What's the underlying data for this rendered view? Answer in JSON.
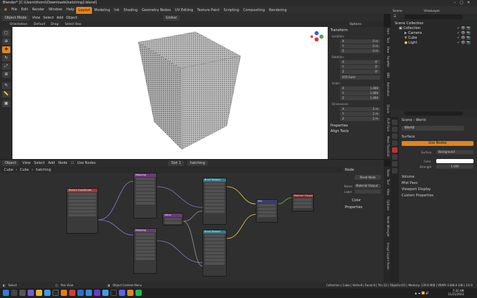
{
  "window_title": "Blender* [C:\\Users\\thomi\\Downloads\\hatching2.blend]",
  "menu": [
    "File",
    "Edit",
    "Render",
    "Window",
    "Help"
  ],
  "workspaces": [
    "Layout",
    "Modeling",
    "Ink",
    "Shading",
    "Geometry Nodes",
    "UV Editing",
    "Texture Paint",
    "Scripting",
    "Compositing",
    "Rendering"
  ],
  "active_workspace": "Layout",
  "scene_label": "Scene",
  "viewlayer_label": "ViewLayer",
  "viewport_header": {
    "mode": "Object Mode",
    "items": [
      "View",
      "Select",
      "Add",
      "Object"
    ],
    "orientation": "Global",
    "options": "Options"
  },
  "viewport_toolhdr": {
    "orientation_label": "Orientation:",
    "orientation_value": "Default",
    "drag_label": "Drag:",
    "drag_value": "Select Box"
  },
  "npanel": {
    "transform_title": "Transform",
    "location_label": "Location:",
    "location": [
      {
        "axis": "X",
        "value": "0 m"
      },
      {
        "axis": "Y",
        "value": "0 m"
      },
      {
        "axis": "Z",
        "value": "0 m"
      }
    ],
    "rotation_label": "Rotation:",
    "rotation": [
      {
        "axis": "X",
        "value": "0°"
      },
      {
        "axis": "Y",
        "value": "0°"
      },
      {
        "axis": "Z",
        "value": "0°"
      }
    ],
    "rotation_mode": "XYZ Euler",
    "scale_label": "Scale:",
    "scale": [
      {
        "axis": "X",
        "value": "1.000"
      },
      {
        "axis": "Y",
        "value": "1.000"
      },
      {
        "axis": "Z",
        "value": "1.000"
      }
    ],
    "dimensions_label": "Dimensions:",
    "dimensions": [
      {
        "axis": "X",
        "value": "2 m"
      },
      {
        "axis": "Y",
        "value": "2 m"
      },
      {
        "axis": "Z",
        "value": "2 m"
      }
    ],
    "properties": "Properties",
    "align_tools": "Align Tools"
  },
  "viewport_tabs": [
    "Item",
    "Tool",
    "View",
    "FaceAttr",
    "BBS",
    "Animation",
    "Qtools",
    "FLIP Fluid",
    "Mesh Tools",
    "Edit",
    "Create"
  ],
  "outliner": {
    "root": "Scene Collection",
    "collection": "Collection",
    "items": [
      "Camera",
      "Cube",
      "Light"
    ]
  },
  "properties": {
    "breadcrumb_scene": "Scene",
    "breadcrumb_world": "World",
    "world_name": "World",
    "surface_title": "Surface",
    "use_nodes": "Use Nodes",
    "surface_label": "Surface",
    "surface_value": "Background",
    "color_label": "Color",
    "strength_label": "Strength",
    "strength_value": "1.000",
    "volume": "Volume",
    "mist_pass": "Mist Pass",
    "viewport_display": "Viewport Display",
    "custom_properties": "Custom Properties"
  },
  "node_header": {
    "type": "Object",
    "items": [
      "View",
      "Select",
      "Add",
      "Node"
    ],
    "use_nodes": "Use Nodes",
    "slot": "Slot 1",
    "material": "hatching"
  },
  "node_breadcrumb": [
    "Cube",
    "Cube",
    "hatching"
  ],
  "node_panel": {
    "title": "Node",
    "reset": "Reset Node",
    "name_label": "Name",
    "name_value": "Material Output",
    "label_label": "Label",
    "color": "Color",
    "properties": "Properties"
  },
  "node_tabs": [
    "Node",
    "Tool",
    "View",
    "Options",
    "Node Wrangler",
    "Image Layers Node"
  ],
  "nodes": [
    {
      "title": "Texture Coordinate",
      "color": "#aa3333"
    },
    {
      "title": "Mapping",
      "color": "#6b3a7a"
    },
    {
      "title": "Mapping",
      "color": "#6b3a7a"
    },
    {
      "title": "Brick Texture",
      "color": "#2f7a8a"
    },
    {
      "title": "Brick Texture",
      "color": "#2f7a8a"
    },
    {
      "title": "Value",
      "color": "#6b3a7a"
    },
    {
      "title": "Mix",
      "color": "#3c3c6e"
    },
    {
      "title": "Material Output",
      "color": "#7a2a2a"
    }
  ],
  "statusbar": {
    "select": "Select",
    "pan": "Pan View",
    "context": "Object Context Menu",
    "stats": "Collection | Cube | Verts:8 | Faces:6 | Tris:12 | Objects:0/3 | Memory: 139.6 MiB | VRAM: 0.8/8.0 GiB | 3.6.0 Geo Engine"
  },
  "clock": {
    "time": "7:33 AM",
    "date": "11/21/2023"
  },
  "colors": {
    "accent": "#e28420",
    "viewport_bg": "#ffffff",
    "panel_bg": "#2e2e2e"
  }
}
